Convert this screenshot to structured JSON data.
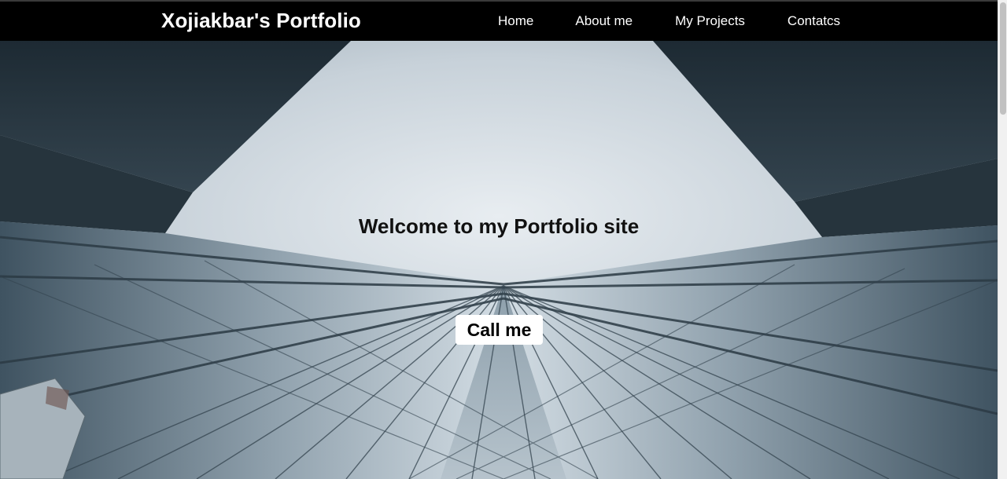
{
  "header": {
    "brand": "Xojiakbar's Portfolio",
    "nav": [
      {
        "label": "Home"
      },
      {
        "label": "About me"
      },
      {
        "label": "My Projects"
      },
      {
        "label": "Contatcs"
      }
    ]
  },
  "hero": {
    "title": "Welcome to my Portfolio site",
    "button_label": "Call me",
    "background": "skyscrapers-looking-up-photo"
  },
  "colors": {
    "nav_bg": "#000000",
    "nav_text": "#ffffff",
    "title_text": "#111111",
    "button_bg": "#ffffff",
    "button_text": "#000000"
  }
}
